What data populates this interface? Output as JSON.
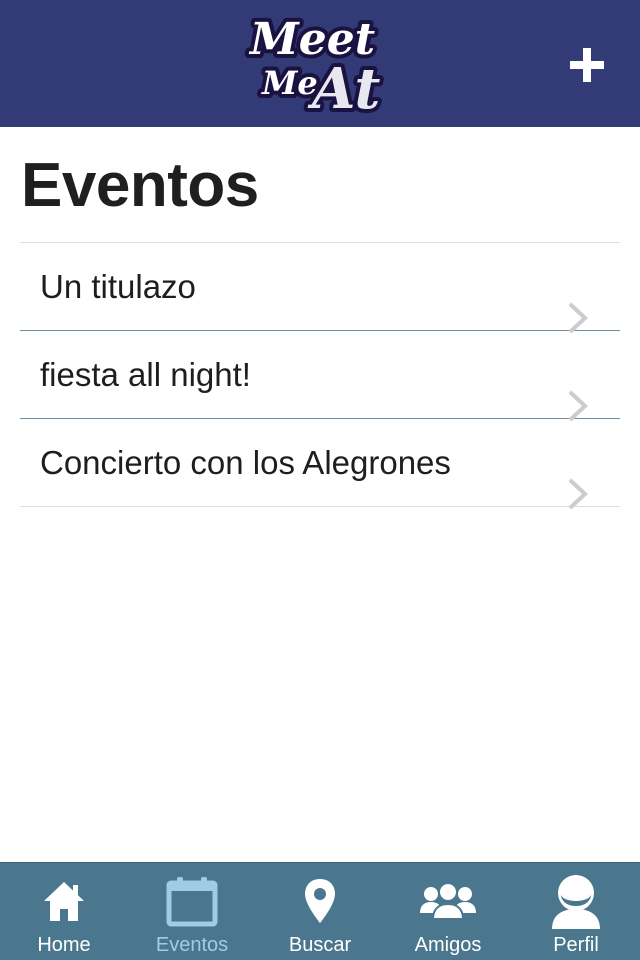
{
  "header": {
    "logo_line1": "Meet",
    "logo_line2": "Me",
    "logo_line3": "At",
    "add_icon": "plus-icon"
  },
  "page": {
    "title": "Eventos"
  },
  "events": [
    {
      "title": "Un titulazo"
    },
    {
      "title": "fiesta all night!"
    },
    {
      "title": "Concierto con los Alegrones"
    }
  ],
  "tabbar": {
    "active": "Eventos",
    "tabs": [
      {
        "label": "Home",
        "icon": "home-icon"
      },
      {
        "label": "Eventos",
        "icon": "calendar-icon"
      },
      {
        "label": "Buscar",
        "icon": "location-pin-icon"
      },
      {
        "label": "Amigos",
        "icon": "friends-icon"
      },
      {
        "label": "Perfil",
        "icon": "profile-icon"
      }
    ]
  },
  "colors": {
    "header_bg": "#323b76",
    "tabbar_bg": "#4a778d",
    "active_tab": "#9fcde6",
    "divider": "#6d8ea5"
  }
}
